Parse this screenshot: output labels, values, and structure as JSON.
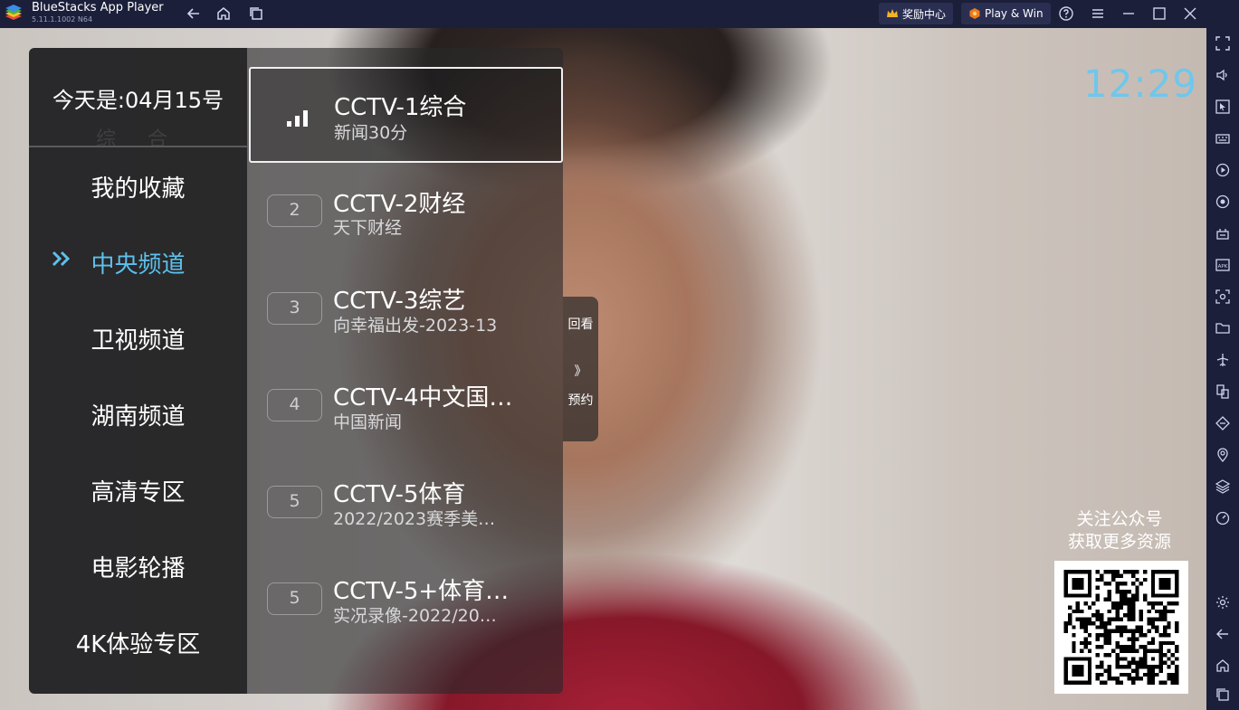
{
  "titlebar": {
    "app_name": "BlueStacks App Player",
    "version": "5.11.1.1002  N64",
    "rewards_label": "奖励中心",
    "play_win_label": "Play & Win"
  },
  "tv": {
    "date_label": "今天是:04月15号",
    "ghost_category": "综 合",
    "active_category": "中央频道",
    "categories": [
      {
        "label": "我的收藏"
      },
      {
        "label": "中央频道"
      },
      {
        "label": "卫视频道"
      },
      {
        "label": "湖南频道"
      },
      {
        "label": "高清专区"
      },
      {
        "label": "电影轮播"
      },
      {
        "label": "4K体验专区"
      }
    ],
    "channels": [
      {
        "number": "",
        "name": "CCTV-1综合",
        "program": "新闻30分",
        "selected": true
      },
      {
        "number": "2",
        "name": "CCTV-2财经",
        "program": "天下财经"
      },
      {
        "number": "3",
        "name": "CCTV-3综艺",
        "program": "向幸福出发-2023-13"
      },
      {
        "number": "4",
        "name": "CCTV-4中文国…",
        "program": "中国新闻"
      },
      {
        "number": "5",
        "name": "CCTV-5体育",
        "program": "2022/2023赛季美…"
      },
      {
        "number": "5",
        "name": "CCTV-5+体育…",
        "program": "实况录像-2022/20…"
      }
    ],
    "side_tab": {
      "top": "回看",
      "arrow": "》",
      "bottom": "预约"
    },
    "clock": "12:29",
    "qr_line1": "关注公众号",
    "qr_line2": "获取更多资源"
  },
  "colors": {
    "accent": "#5cc1ec",
    "clock": "#6fc7ec",
    "titlebar_bg": "#1b1f3a"
  },
  "icons": {
    "titlebar": [
      "back-icon",
      "home-icon",
      "multi-instance-icon",
      "crown-icon",
      "play-win-icon",
      "help-icon",
      "menu-icon",
      "minimize-icon",
      "maximize-icon",
      "close-icon"
    ],
    "sidebar": [
      "fullscreen-icon",
      "volume-icon",
      "pointer-icon",
      "keyboard-icon",
      "record-icon",
      "rotate-icon",
      "apk-install-icon",
      "apk-icon",
      "screenshot-icon",
      "folder-icon",
      "airplane-icon",
      "multi-instance-sync-icon",
      "eco-mode-icon",
      "location-icon",
      "layers-icon",
      "speed-icon",
      "settings-icon",
      "android-back-icon",
      "android-home-icon",
      "android-recents-icon"
    ]
  }
}
